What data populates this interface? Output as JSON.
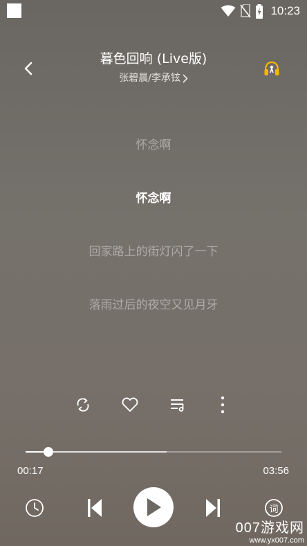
{
  "status_bar": {
    "time": "10:23",
    "icons": [
      "wifi-icon",
      "no-sim-icon",
      "battery-charging-icon"
    ]
  },
  "header": {
    "title": "暮色回响 (Live版)",
    "artists": "张碧晨/李承铉",
    "back_icon": "back-arrow-icon",
    "headphone_icon": "headphone-icon"
  },
  "lyrics": [
    {
      "text": "怀念啊",
      "active": false
    },
    {
      "text": "怀念啊",
      "active": true
    },
    {
      "text": "回家路上的街灯闪了一下",
      "active": false
    },
    {
      "text": "落雨过后的夜空又见月牙",
      "active": false
    }
  ],
  "actions": [
    "repeat-icon",
    "heart-icon",
    "playlist-icon",
    "more-icon"
  ],
  "progress": {
    "current": "00:17",
    "total": "03:56",
    "played_fraction": 0.09,
    "buffered_fraction": 0.55
  },
  "controls": [
    "timer-icon",
    "previous-icon",
    "play-icon",
    "next-icon",
    "lyrics-toggle-icon"
  ],
  "lyrics_toggle_label": "词",
  "watermark": {
    "main": "007游戏网",
    "url": "www.yx007.com"
  },
  "colors": {
    "accent": "#f5b800",
    "inactive_lyric": "#aeaaa5"
  }
}
